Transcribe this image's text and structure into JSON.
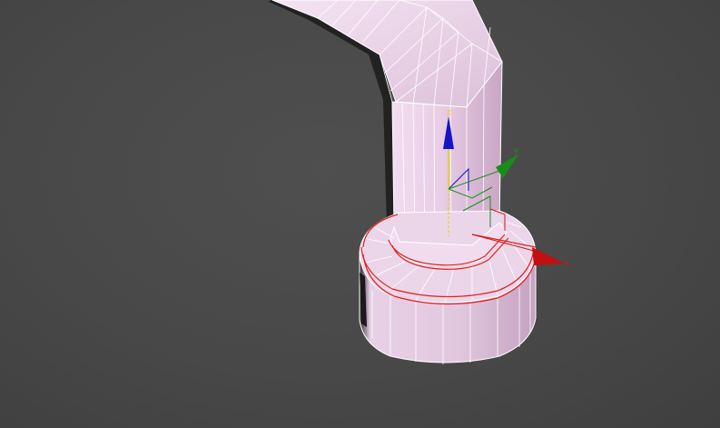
{
  "viewport": {
    "background_color": "#454545",
    "shading_mode": "edged-faces",
    "object_color": "#d9b8d6",
    "selection_edge_color": "#e0201e"
  },
  "gizmo": {
    "type": "move-transform-gizmo",
    "axes": [
      {
        "name": "x",
        "label": "x",
        "color": "#d41414"
      },
      {
        "name": "y",
        "label": "y",
        "color": "#1a8c1a"
      },
      {
        "name": "z",
        "label": "z",
        "color": "#1414c8"
      }
    ],
    "highlight_color": "#e6d200"
  }
}
